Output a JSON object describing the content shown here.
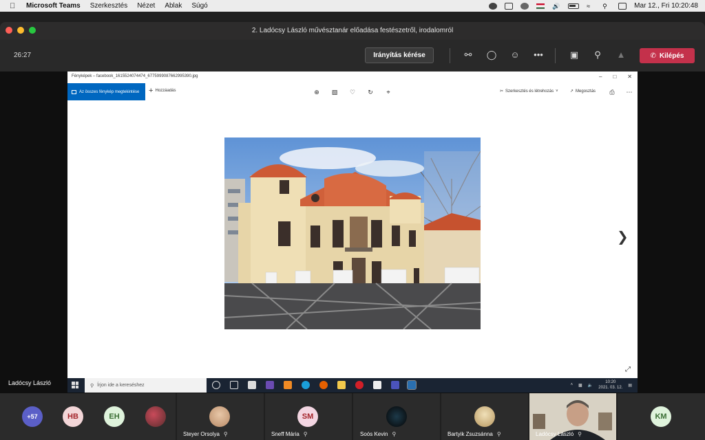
{
  "menubar": {
    "app": "Microsoft Teams",
    "items": [
      "Szerkesztés",
      "Nézet",
      "Ablak",
      "Súgó"
    ],
    "clock": "Mar 12., Fri  10:20:48"
  },
  "window": {
    "title": "2. Ladócsy László művésztanár előadása festészetről, irodalomról"
  },
  "meeting": {
    "timer": "26:27",
    "request_control": "Irányítás kérése",
    "leave": "Kilépés",
    "presenter": "Ladócsy László"
  },
  "photos_app": {
    "title": "Fényképek – facebook_1615524074474_6775999087662995390.jpg",
    "all_photos": "Az összes fénykép megtekintése",
    "add": "Hozzáadás",
    "edit_create": "Szerkesztés és létrehozás",
    "share": "Megosztás"
  },
  "taskbar": {
    "search_placeholder": "Írjon ide a kereséshez",
    "time": "10:20",
    "date": "2021. 03. 12."
  },
  "participants": {
    "overflow": "+57",
    "initials": [
      {
        "text": "HB",
        "bg": "#f3d6d8",
        "fg": "#a4262c"
      },
      {
        "text": "EH",
        "bg": "#dff3dc",
        "fg": "#3a6e34"
      },
      {
        "text": "SM",
        "bg": "#f3d6e2",
        "fg": "#a4262c"
      },
      {
        "text": "KM",
        "bg": "#dff3dc",
        "fg": "#3a6e34"
      }
    ],
    "names": [
      "Steyer Orsolya",
      "Sneff Mária",
      "Soós Kevin",
      "Bartyik Zsuzsánna",
      "Ladócsy László"
    ]
  },
  "colors": {
    "leave": "#c4314b",
    "accent": "#0067c0",
    "overflow": "#5b5fc7"
  }
}
